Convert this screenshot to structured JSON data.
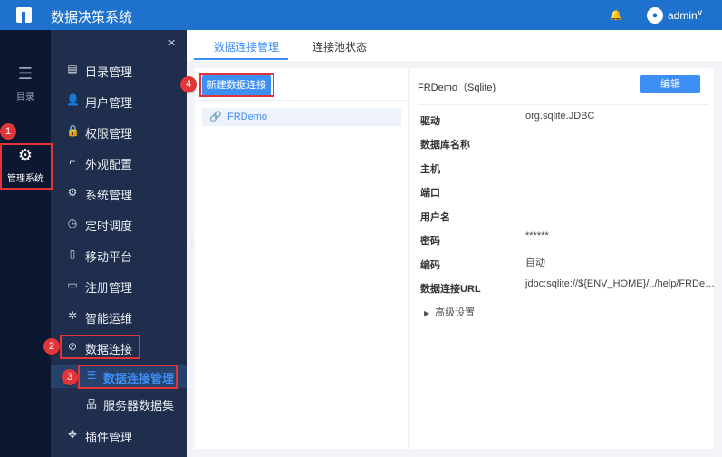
{
  "header": {
    "title": "数据决策系统",
    "user": "admin",
    "icons": [
      "logo-icon",
      "bell-icon",
      "avatar-icon",
      "chevron-down-icon"
    ]
  },
  "rail": [
    {
      "label": "目录",
      "icon": "list-icon"
    },
    {
      "label": "管理系统",
      "icon": "gear-icon"
    }
  ],
  "menu": {
    "items": [
      {
        "label": "目录管理",
        "icon": "catalog-icon"
      },
      {
        "label": "用户管理",
        "icon": "user-icon"
      },
      {
        "label": "权限管理",
        "icon": "lock-icon"
      },
      {
        "label": "外观配置",
        "icon": "paint-roller-icon"
      },
      {
        "label": "系统管理",
        "icon": "gear-icon"
      },
      {
        "label": "定时调度",
        "icon": "stopwatch-icon"
      },
      {
        "label": "移动平台",
        "icon": "mobile-icon"
      },
      {
        "label": "注册管理",
        "icon": "register-icon"
      },
      {
        "label": "智能运维",
        "icon": "ops-icon"
      },
      {
        "label": "数据连接",
        "icon": "paperclip-icon"
      },
      {
        "label": "数据连接管理",
        "icon": "database-icon"
      },
      {
        "label": "服务器数据集",
        "icon": "dataset-icon"
      },
      {
        "label": "插件管理",
        "icon": "puzzle-icon"
      }
    ]
  },
  "badges": [
    "1",
    "2",
    "3",
    "4"
  ],
  "tabs": [
    "数据连接管理",
    "连接池状态"
  ],
  "left": {
    "new_button": "新建数据连接",
    "connections": [
      "FRDemo"
    ]
  },
  "detail": {
    "title": "FRDemo（Sqlite)",
    "edit_button": "编辑",
    "fields": [
      {
        "key": "驱动",
        "value": "org.sqlite.JDBC"
      },
      {
        "key": "数据库名称",
        "value": ""
      },
      {
        "key": "主机",
        "value": ""
      },
      {
        "key": "端口",
        "value": ""
      },
      {
        "key": "用户名",
        "value": ""
      },
      {
        "key": "密码",
        "value": "******"
      },
      {
        "key": "编码",
        "value": "自动"
      },
      {
        "key": "数据连接URL",
        "value": "jdbc:sqlite://${ENV_HOME}/../help/FRDe…"
      }
    ],
    "advanced": "高级设置"
  },
  "colors": {
    "header": "#1e72ce",
    "accent": "#3d8ff5",
    "highlight": "#e2353a"
  }
}
